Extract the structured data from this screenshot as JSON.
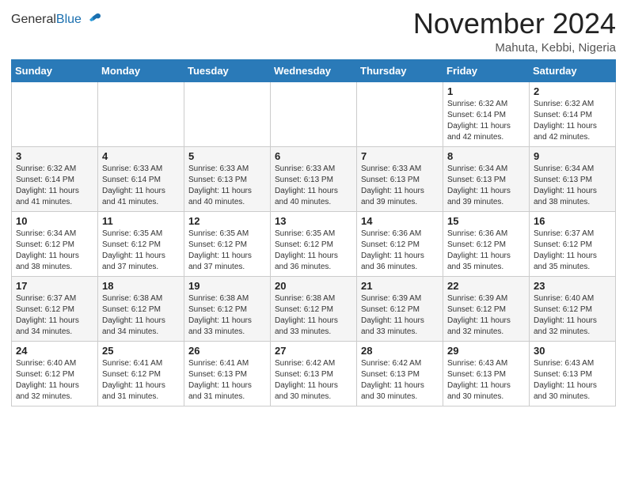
{
  "header": {
    "logo_general": "General",
    "logo_blue": "Blue",
    "month_title": "November 2024",
    "location": "Mahuta, Kebbi, Nigeria"
  },
  "days_of_week": [
    "Sunday",
    "Monday",
    "Tuesday",
    "Wednesday",
    "Thursday",
    "Friday",
    "Saturday"
  ],
  "weeks": [
    [
      {
        "day": "",
        "info": ""
      },
      {
        "day": "",
        "info": ""
      },
      {
        "day": "",
        "info": ""
      },
      {
        "day": "",
        "info": ""
      },
      {
        "day": "",
        "info": ""
      },
      {
        "day": "1",
        "info": "Sunrise: 6:32 AM\nSunset: 6:14 PM\nDaylight: 11 hours\nand 42 minutes."
      },
      {
        "day": "2",
        "info": "Sunrise: 6:32 AM\nSunset: 6:14 PM\nDaylight: 11 hours\nand 42 minutes."
      }
    ],
    [
      {
        "day": "3",
        "info": "Sunrise: 6:32 AM\nSunset: 6:14 PM\nDaylight: 11 hours\nand 41 minutes."
      },
      {
        "day": "4",
        "info": "Sunrise: 6:33 AM\nSunset: 6:14 PM\nDaylight: 11 hours\nand 41 minutes."
      },
      {
        "day": "5",
        "info": "Sunrise: 6:33 AM\nSunset: 6:13 PM\nDaylight: 11 hours\nand 40 minutes."
      },
      {
        "day": "6",
        "info": "Sunrise: 6:33 AM\nSunset: 6:13 PM\nDaylight: 11 hours\nand 40 minutes."
      },
      {
        "day": "7",
        "info": "Sunrise: 6:33 AM\nSunset: 6:13 PM\nDaylight: 11 hours\nand 39 minutes."
      },
      {
        "day": "8",
        "info": "Sunrise: 6:34 AM\nSunset: 6:13 PM\nDaylight: 11 hours\nand 39 minutes."
      },
      {
        "day": "9",
        "info": "Sunrise: 6:34 AM\nSunset: 6:13 PM\nDaylight: 11 hours\nand 38 minutes."
      }
    ],
    [
      {
        "day": "10",
        "info": "Sunrise: 6:34 AM\nSunset: 6:12 PM\nDaylight: 11 hours\nand 38 minutes."
      },
      {
        "day": "11",
        "info": "Sunrise: 6:35 AM\nSunset: 6:12 PM\nDaylight: 11 hours\nand 37 minutes."
      },
      {
        "day": "12",
        "info": "Sunrise: 6:35 AM\nSunset: 6:12 PM\nDaylight: 11 hours\nand 37 minutes."
      },
      {
        "day": "13",
        "info": "Sunrise: 6:35 AM\nSunset: 6:12 PM\nDaylight: 11 hours\nand 36 minutes."
      },
      {
        "day": "14",
        "info": "Sunrise: 6:36 AM\nSunset: 6:12 PM\nDaylight: 11 hours\nand 36 minutes."
      },
      {
        "day": "15",
        "info": "Sunrise: 6:36 AM\nSunset: 6:12 PM\nDaylight: 11 hours\nand 35 minutes."
      },
      {
        "day": "16",
        "info": "Sunrise: 6:37 AM\nSunset: 6:12 PM\nDaylight: 11 hours\nand 35 minutes."
      }
    ],
    [
      {
        "day": "17",
        "info": "Sunrise: 6:37 AM\nSunset: 6:12 PM\nDaylight: 11 hours\nand 34 minutes."
      },
      {
        "day": "18",
        "info": "Sunrise: 6:38 AM\nSunset: 6:12 PM\nDaylight: 11 hours\nand 34 minutes."
      },
      {
        "day": "19",
        "info": "Sunrise: 6:38 AM\nSunset: 6:12 PM\nDaylight: 11 hours\nand 33 minutes."
      },
      {
        "day": "20",
        "info": "Sunrise: 6:38 AM\nSunset: 6:12 PM\nDaylight: 11 hours\nand 33 minutes."
      },
      {
        "day": "21",
        "info": "Sunrise: 6:39 AM\nSunset: 6:12 PM\nDaylight: 11 hours\nand 33 minutes."
      },
      {
        "day": "22",
        "info": "Sunrise: 6:39 AM\nSunset: 6:12 PM\nDaylight: 11 hours\nand 32 minutes."
      },
      {
        "day": "23",
        "info": "Sunrise: 6:40 AM\nSunset: 6:12 PM\nDaylight: 11 hours\nand 32 minutes."
      }
    ],
    [
      {
        "day": "24",
        "info": "Sunrise: 6:40 AM\nSunset: 6:12 PM\nDaylight: 11 hours\nand 32 minutes."
      },
      {
        "day": "25",
        "info": "Sunrise: 6:41 AM\nSunset: 6:12 PM\nDaylight: 11 hours\nand 31 minutes."
      },
      {
        "day": "26",
        "info": "Sunrise: 6:41 AM\nSunset: 6:13 PM\nDaylight: 11 hours\nand 31 minutes."
      },
      {
        "day": "27",
        "info": "Sunrise: 6:42 AM\nSunset: 6:13 PM\nDaylight: 11 hours\nand 30 minutes."
      },
      {
        "day": "28",
        "info": "Sunrise: 6:42 AM\nSunset: 6:13 PM\nDaylight: 11 hours\nand 30 minutes."
      },
      {
        "day": "29",
        "info": "Sunrise: 6:43 AM\nSunset: 6:13 PM\nDaylight: 11 hours\nand 30 minutes."
      },
      {
        "day": "30",
        "info": "Sunrise: 6:43 AM\nSunset: 6:13 PM\nDaylight: 11 hours\nand 30 minutes."
      }
    ]
  ]
}
